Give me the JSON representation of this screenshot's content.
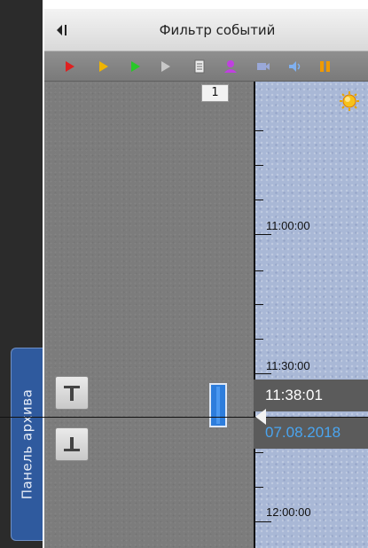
{
  "archive_panel": {
    "tab_label": "Панель архива"
  },
  "header": {
    "title": "Фильтр событий",
    "collapse_icon": "collapse-left-icon"
  },
  "toolbar": {
    "filters": [
      {
        "name": "alarm-filter",
        "icon": "play-triangle-icon",
        "color": "#e02020"
      },
      {
        "name": "warning-filter",
        "icon": "play-triangle-icon",
        "color": "#f0b400"
      },
      {
        "name": "normal-filter",
        "icon": "play-triangle-icon",
        "color": "#28c828"
      },
      {
        "name": "info-filter",
        "icon": "play-triangle-icon",
        "color": "#c8c8c8"
      },
      {
        "name": "text-filter",
        "icon": "document-icon",
        "color": "#e6e6e6"
      },
      {
        "name": "face-filter",
        "icon": "person-icon",
        "color": "#c040e0"
      },
      {
        "name": "video-filter",
        "icon": "camera-icon",
        "color": "#9aa8d8"
      },
      {
        "name": "audio-filter",
        "icon": "speaker-icon",
        "color": "#7fb0f0"
      },
      {
        "name": "pause-filter",
        "icon": "pause-icon",
        "color": "#f09a00"
      }
    ]
  },
  "camera": {
    "counter": "1"
  },
  "timeline": {
    "labels": [
      "11:00:00",
      "11:30:00",
      "12:00:00"
    ],
    "cursor_time": "11:38:01",
    "cursor_date": "07.08.2018",
    "weather_icon": "sun-icon"
  },
  "colors": {
    "timeline_bg": "#a9b8d6",
    "archive_tab": "#2f5a9e",
    "event_bar": "#2d7ddc",
    "date_text": "#4aa5f0"
  }
}
